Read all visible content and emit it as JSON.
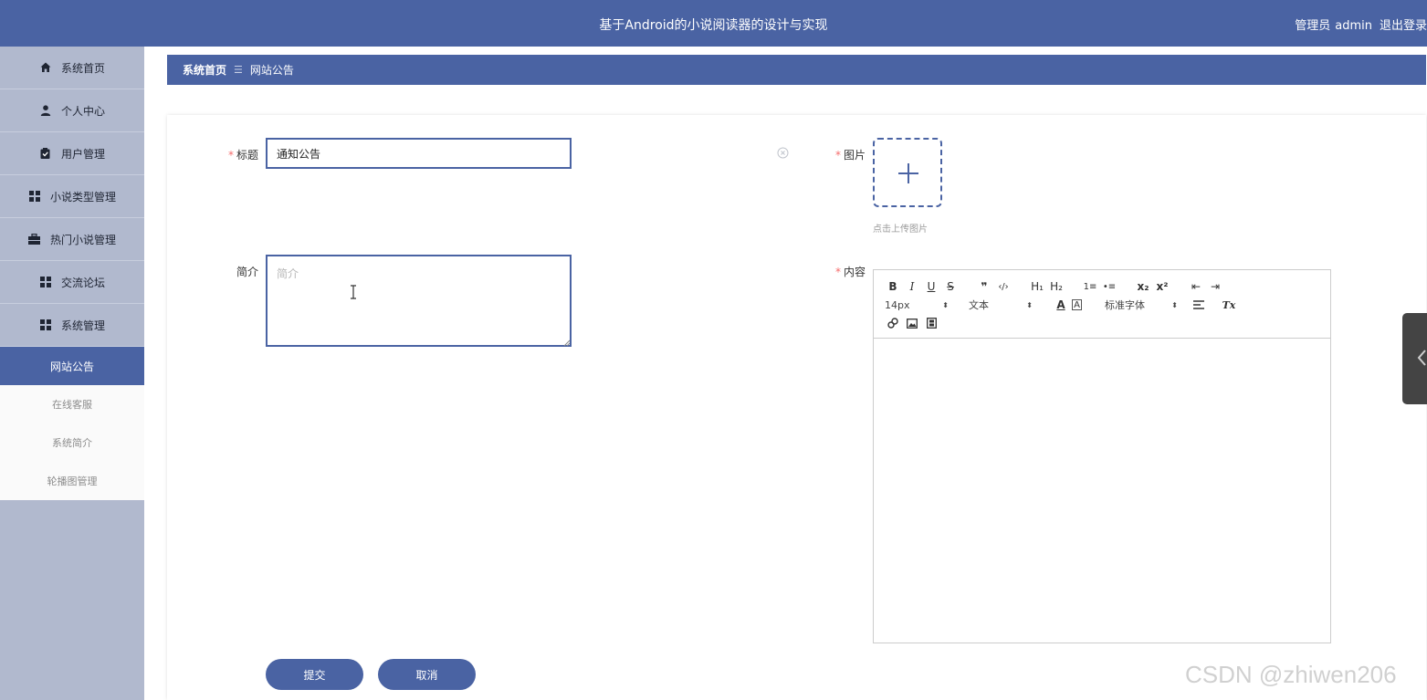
{
  "header": {
    "title": "基于Android的小说阅读器的设计与实现",
    "user_role": "管理员",
    "username": "admin",
    "logout": "退出登录"
  },
  "sidebar": {
    "items": [
      {
        "label": "系统首页",
        "icon": "home-icon"
      },
      {
        "label": "个人中心",
        "icon": "user-icon"
      },
      {
        "label": "用户管理",
        "icon": "clipboard-icon"
      },
      {
        "label": "小说类型管理",
        "icon": "grid-icon"
      },
      {
        "label": "热门小说管理",
        "icon": "briefcase-icon"
      },
      {
        "label": "交流论坛",
        "icon": "grid-icon"
      },
      {
        "label": "系统管理",
        "icon": "grid-icon"
      }
    ],
    "subitems": [
      {
        "label": "网站公告",
        "active": true
      },
      {
        "label": "在线客服",
        "active": false
      },
      {
        "label": "系统简介",
        "active": false
      },
      {
        "label": "轮播图管理",
        "active": false
      }
    ]
  },
  "breadcrumb": {
    "home": "系统首页",
    "separator": "☰",
    "current": "网站公告"
  },
  "form": {
    "title_label": "标题",
    "title_value": "通知公告",
    "intro_label": "简介",
    "intro_placeholder": "简介",
    "image_label": "图片",
    "upload_tip": "点击上传图片",
    "content_label": "内容",
    "required_mark": "*",
    "submit": "提交",
    "cancel": "取消"
  },
  "editor": {
    "row1": [
      "B",
      "I",
      "U",
      "S",
      "❞",
      "‹/›",
      "H₁",
      "H₂",
      "1≡",
      "•≡",
      "x₂",
      "x²",
      "⇤",
      "⇥"
    ],
    "font_size": "14px",
    "text_style": "文本",
    "font_color": "A",
    "bg_color": "A",
    "font_family": "标准字体",
    "clear_format": "Tx"
  },
  "watermark": "CSDN @zhiwen206",
  "colors": {
    "primary": "#4a63a3",
    "sidebar_bg": "#b1b9ce",
    "required": "#f56c6c"
  }
}
